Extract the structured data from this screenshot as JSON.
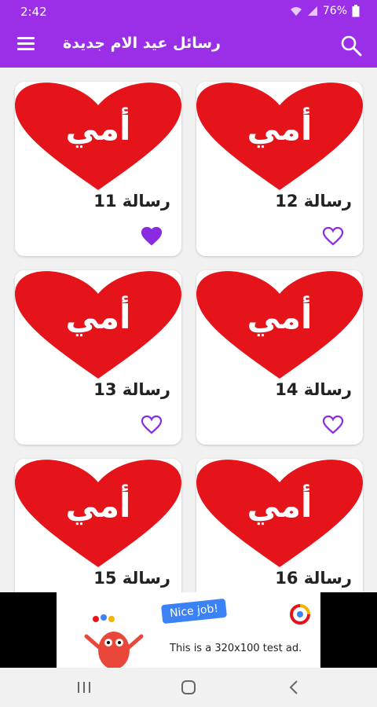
{
  "status_bar": {
    "time": "2:42",
    "battery": "76%"
  },
  "app_bar": {
    "title": "رسائل عيد الام جديدة",
    "menu_icon": "hamburger-menu-icon",
    "search_icon": "search-icon"
  },
  "colors": {
    "primary": "#9b2fe8",
    "heart_red": "#e4141a",
    "favorite_purple": "#8a2be2"
  },
  "cards": [
    {
      "image_text": "أمي",
      "label": "رسالة 12",
      "favorited": false
    },
    {
      "image_text": "أمي",
      "label": "رسالة 11",
      "favorited": true
    },
    {
      "image_text": "أمي",
      "label": "رسالة 14",
      "favorited": false
    },
    {
      "image_text": "أمي",
      "label": "رسالة 13",
      "favorited": false
    },
    {
      "image_text": "أمي",
      "label": "رسالة 16",
      "favorited": false
    },
    {
      "image_text": "أمي",
      "label": "رسالة 15",
      "favorited": false
    }
  ],
  "ad": {
    "bubble": "Nice job!",
    "text": "This is a 320x100 test ad."
  },
  "nav": {
    "recent_icon": "recent-apps-icon",
    "home_icon": "home-icon",
    "back_icon": "back-icon"
  }
}
